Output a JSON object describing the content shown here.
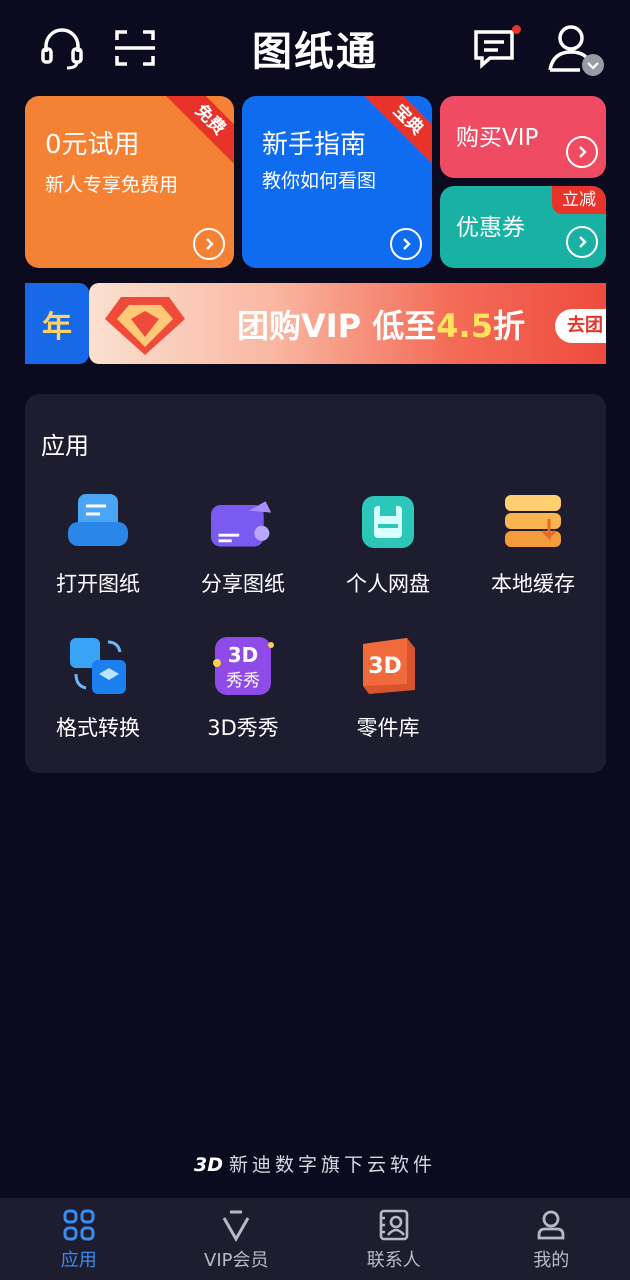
{
  "header": {
    "logo_text": "图纸通",
    "icons": [
      "headset-icon",
      "scan-icon",
      "message-icon",
      "user-icon"
    ]
  },
  "cards": {
    "trial": {
      "title": "0元试用",
      "subtitle": "新人专享免费用",
      "ribbon": "免费",
      "color": "#f58234"
    },
    "guide": {
      "title": "新手指南",
      "subtitle": "教你如何看图",
      "ribbon": "宝典",
      "color": "#0f6cf0"
    },
    "vip": {
      "title": "购买VIP",
      "color": "#ef4b62"
    },
    "coupon": {
      "title": "优惠券",
      "tag": "立减",
      "color": "#18b1a3"
    }
  },
  "banner": {
    "left_char": "年",
    "text": "团购VIP 低至",
    "discount": "4.5",
    "suffix": "折",
    "button": "去团"
  },
  "apps": {
    "title": "应用",
    "items": [
      {
        "label": "打开图纸",
        "icon": "open-drawing-icon"
      },
      {
        "label": "分享图纸",
        "icon": "share-drawing-icon"
      },
      {
        "label": "个人网盘",
        "icon": "cloud-disk-icon"
      },
      {
        "label": "本地缓存",
        "icon": "local-cache-icon"
      },
      {
        "label": "格式转换",
        "icon": "format-convert-icon"
      },
      {
        "label": "3D秀秀",
        "icon": "3d-show-icon"
      },
      {
        "label": "零件库",
        "icon": "parts-library-icon"
      }
    ]
  },
  "footer": {
    "brand": "新迪数字旗下云软件"
  },
  "tabbar": {
    "items": [
      {
        "label": "应用",
        "icon": "apps-grid-icon",
        "active": true
      },
      {
        "label": "VIP会员",
        "icon": "vip-icon",
        "active": false
      },
      {
        "label": "联系人",
        "icon": "contacts-icon",
        "active": false
      },
      {
        "label": "我的",
        "icon": "profile-icon",
        "active": false
      }
    ]
  },
  "colors": {
    "background": "#0b0a1e",
    "panel": "#1d1d2f",
    "accent": "#3b8cf0",
    "badge": "#e8332a"
  }
}
